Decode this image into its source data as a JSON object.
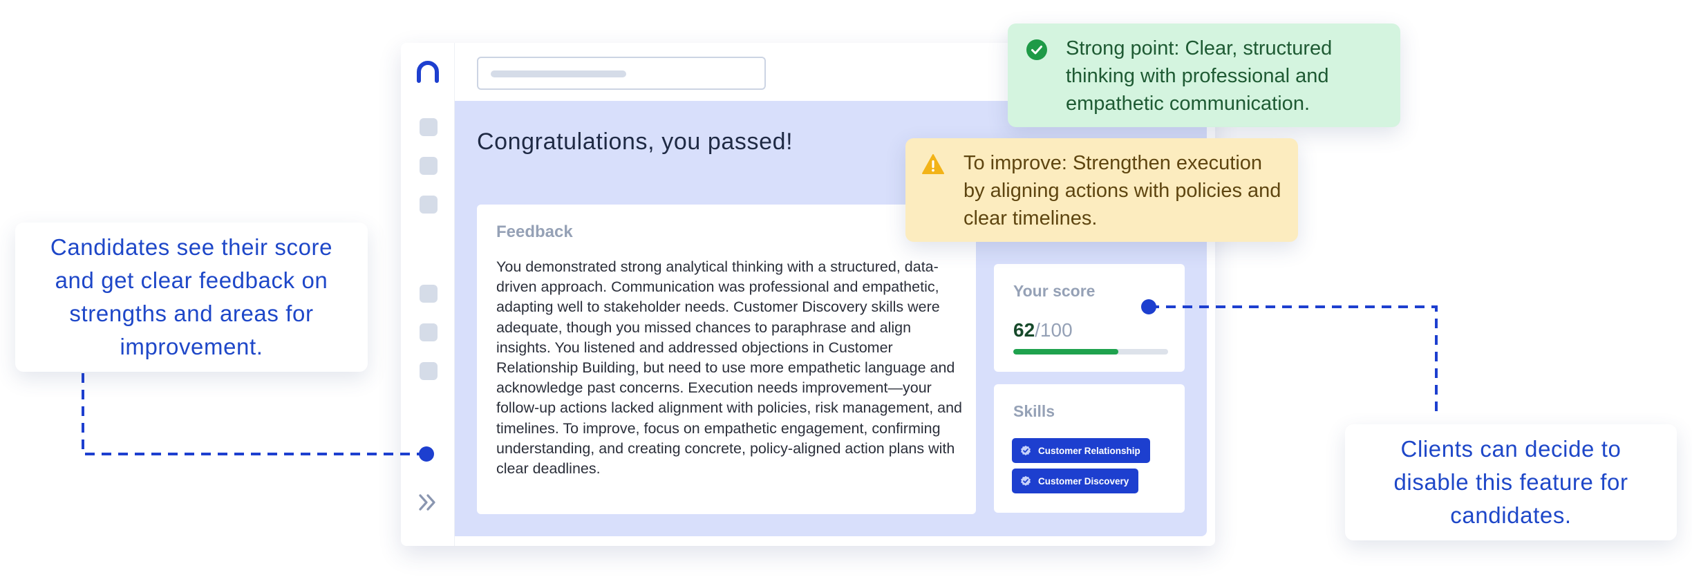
{
  "main": {
    "title": "Congratulations, you passed!"
  },
  "feedback": {
    "heading": "Feedback",
    "body": "You demonstrated strong analytical thinking with a structured, data-driven approach. Communication was professional and empathetic, adapting well to stakeholder needs. Customer Discovery skills were adequate, though you missed chances to paraphrase and align insights. You listened and addressed objections in Customer Relationship Building, but need to use more empathetic language and acknowledge past concerns. Execution needs improvement—your follow-up actions lacked alignment with policies, risk management, and timelines. To improve, focus on empathetic engagement, confirming understanding, and creating concrete, policy-aligned action plans with clear deadlines."
  },
  "score": {
    "heading": "Your score",
    "value": "62",
    "total": "/100",
    "progress_fraction": 0.68,
    "bar_color": "#1fa24e"
  },
  "skills": {
    "heading": "Skills",
    "chips": [
      {
        "label": "Customer Relationship",
        "icon": "check-badge-icon"
      },
      {
        "label": "Customer Discovery",
        "icon": "check-badge-icon"
      }
    ]
  },
  "callouts": {
    "strong": {
      "text": "Strong point: Clear, structured thinking with professional and empathetic communication.",
      "icon": "check-circle-icon",
      "color": "#1e9a47"
    },
    "improve": {
      "text": "To improve: Strengthen execution by aligning actions with policies and clear timelines.",
      "icon": "warning-triangle-icon",
      "color": "#f2b318"
    }
  },
  "notes": {
    "left": "Candidates see their score and get clear feedback on strengths and areas for improvement.",
    "right": "Clients can decide to disable this feature for candidates."
  },
  "theme": {
    "accent": "#1d3fcf",
    "panel_bg": "#d8dffb",
    "connector": "#1d3fcf"
  },
  "sidebar": {
    "items": [
      "nav-icon-1",
      "nav-icon-2",
      "nav-icon-3",
      "nav-icon-4",
      "nav-icon-5",
      "nav-icon-6"
    ]
  }
}
